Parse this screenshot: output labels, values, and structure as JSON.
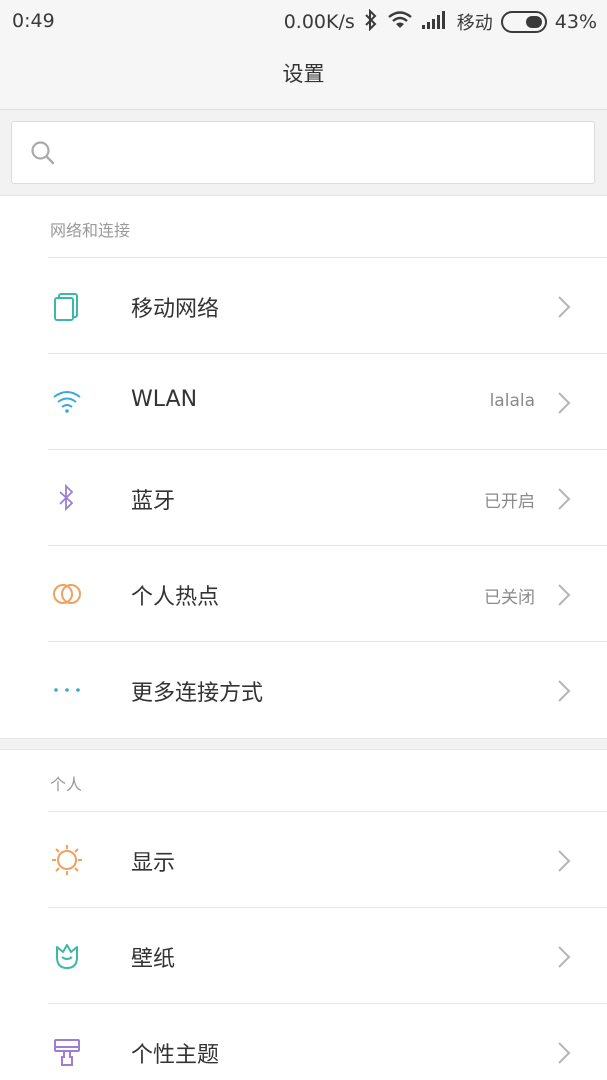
{
  "status_bar": {
    "time": "0:49",
    "network_speed": "0.00K/s",
    "carrier": "移动",
    "battery": "43%",
    "icons": [
      "bluetooth-icon",
      "wifi-icon",
      "signal-icon",
      "battery-icon"
    ]
  },
  "nav": {
    "title": "设置"
  },
  "search": {
    "placeholder": "",
    "value": ""
  },
  "sections": [
    {
      "header": "网络和连接",
      "items": [
        {
          "label": "移动网络",
          "value": "",
          "icon": "sim-card-icon",
          "color": "#3cb9a4"
        },
        {
          "label": "WLAN",
          "value": "lalala",
          "icon": "wifi-icon",
          "color": "#39a9e0"
        },
        {
          "label": "蓝牙",
          "value": "已开启",
          "icon": "bluetooth-icon",
          "color": "#9b7fd6"
        },
        {
          "label": "个人热点",
          "value": "已关闭",
          "icon": "hotspot-rings-icon",
          "color": "#f0a060"
        },
        {
          "label": "更多连接方式",
          "value": "",
          "icon": "more-dots-icon",
          "color": "#3aa8c8"
        }
      ]
    },
    {
      "header": "个人",
      "items": [
        {
          "label": "显示",
          "value": "",
          "icon": "sun-icon",
          "color": "#f0a060"
        },
        {
          "label": "壁纸",
          "value": "",
          "icon": "tulip-icon",
          "color": "#3cb9a4"
        },
        {
          "label": "个性主题",
          "value": "",
          "icon": "brush-icon",
          "color": "#9b7fd6"
        }
      ]
    }
  ],
  "colors": {
    "background": "#ffffff",
    "divider": "#e6e6e6",
    "section_bg": "#f2f2f2"
  }
}
